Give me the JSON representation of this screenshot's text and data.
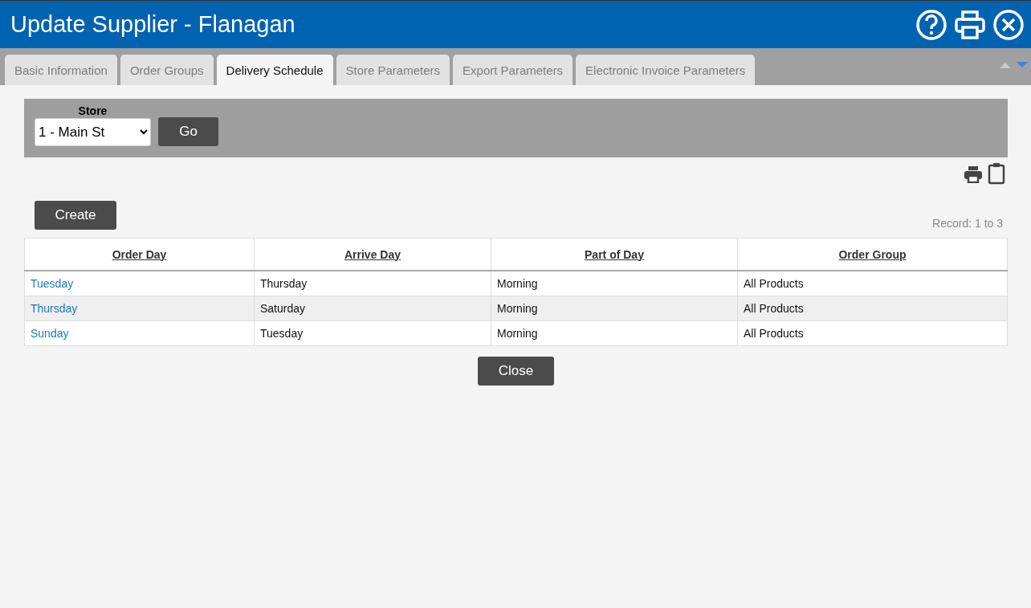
{
  "window": {
    "title": "Update Supplier - Flanagan"
  },
  "tabs": [
    {
      "label": "Basic Information",
      "selected": false
    },
    {
      "label": "Order Groups",
      "selected": false
    },
    {
      "label": "Delivery Schedule",
      "selected": true
    },
    {
      "label": "Store Parameters",
      "selected": false
    },
    {
      "label": "Export Parameters",
      "selected": false
    },
    {
      "label": "Electronic Invoice Parameters",
      "selected": false
    }
  ],
  "filter": {
    "label": "Store",
    "value": "1 - Main St",
    "button": "Go"
  },
  "create_button": "Create",
  "record_count": "Record: 1 to 3",
  "table": {
    "columns": [
      "Order Day",
      "Arrive Day",
      "Part of Day",
      "Order Group"
    ],
    "rows": [
      [
        "Tuesday",
        "Thursday",
        "Morning",
        "All Products"
      ],
      [
        "Thursday",
        "Saturday",
        "Morning",
        "All Products"
      ],
      [
        "Sunday",
        "Tuesday",
        "Morning",
        "All Products"
      ]
    ]
  },
  "close_button": "Close"
}
